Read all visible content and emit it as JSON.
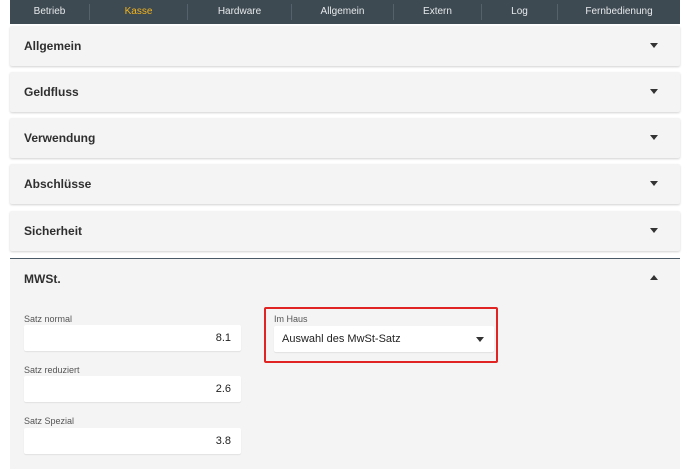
{
  "nav": {
    "tabs": [
      "Betrieb",
      "Kasse",
      "Hardware",
      "Allgemein",
      "Extern",
      "Log",
      "Fernbedienung"
    ],
    "active": "Kasse",
    "active_color": "#f2b31d"
  },
  "panels": [
    "Allgemein",
    "Geldfluss",
    "Verwendung",
    "Abschlüsse",
    "Sicherheit"
  ],
  "mwst": {
    "title": "MWSt.",
    "satz_normal": {
      "label": "Satz normal",
      "value": "8.1"
    },
    "satz_reduziert": {
      "label": "Satz reduziert",
      "value": "2.6"
    },
    "satz_spezial": {
      "label": "Satz Spezial",
      "value": "3.8"
    },
    "im_haus": {
      "label": "Im Haus",
      "selected": "Auswahl des MwSt-Satz"
    }
  },
  "highlight_color": "#e02424"
}
